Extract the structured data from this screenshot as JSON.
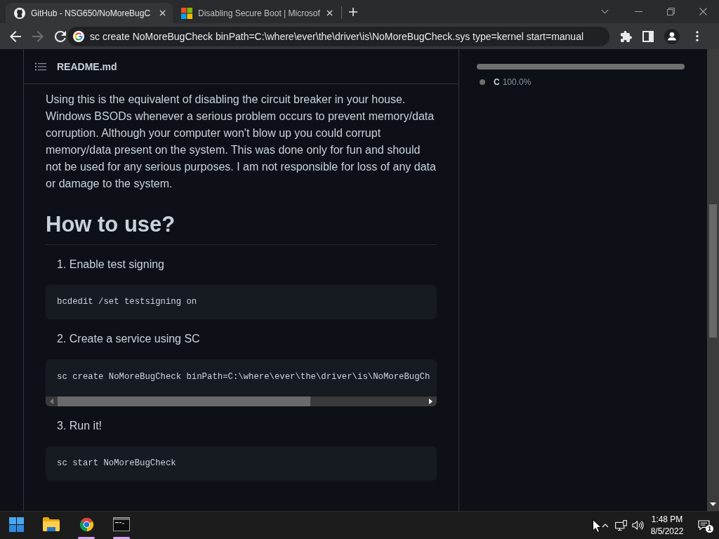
{
  "browser": {
    "tabs": [
      {
        "title": "GitHub - NSG650/NoMoreBugC",
        "kind": "octocat",
        "selected": true
      },
      {
        "title": "Disabling Secure Boot | Microsof",
        "kind": "four-squares",
        "selected": false
      }
    ],
    "nav_buttons": [
      {
        "kind": "back",
        "disabled": false
      },
      {
        "kind": "forward",
        "disabled": true
      },
      {
        "kind": "reload",
        "disabled": false
      }
    ],
    "address_bar": {
      "value": "sc create NoMoreBugCheck binPath=C:\\where\\ever\\the\\driver\\is\\NoMoreBugCheck.sys type=kernel start=manual"
    }
  },
  "readme": {
    "title": "README.md",
    "paragraph": "Using this is the equivalent of disabling the circuit breaker in your house. Windows BSODs whenever a serious problem occurs to prevent memory/data corruption. Although your computer won't blow up you could corrupt memory/data present on the system. This was done only for fun and should not be used for any serious purposes. I am not responsible for loss of any data or damage to the system.",
    "heading": "How to use?",
    "steps": [
      {
        "number": "1.",
        "text": "Enable test signing",
        "code": "bcdedit /set testsigning on",
        "scrollbar": false
      },
      {
        "number": "2.",
        "text": "Create a service using SC",
        "code": "sc create NoMoreBugCheck binPath=C:\\where\\ever\\the\\driver\\is\\NoMoreBugCh",
        "scrollbar": true
      },
      {
        "number": "3.",
        "text": "Run it!",
        "code": "sc start NoMoreBugCheck",
        "scrollbar": false
      }
    ]
  },
  "sidebar": {
    "languages": [
      {
        "name": "C",
        "percent": "100.0%",
        "color": "#6e6e6e",
        "level": 1
      }
    ]
  },
  "taskbar": {
    "apps": [
      {
        "kind": "start",
        "running": false
      },
      {
        "kind": "explorer",
        "running": false
      },
      {
        "kind": "chrome",
        "running": true
      },
      {
        "kind": "terminal",
        "running": true
      }
    ],
    "time": "1:48 PM",
    "date": "8/5/2022",
    "notifications": "1"
  }
}
